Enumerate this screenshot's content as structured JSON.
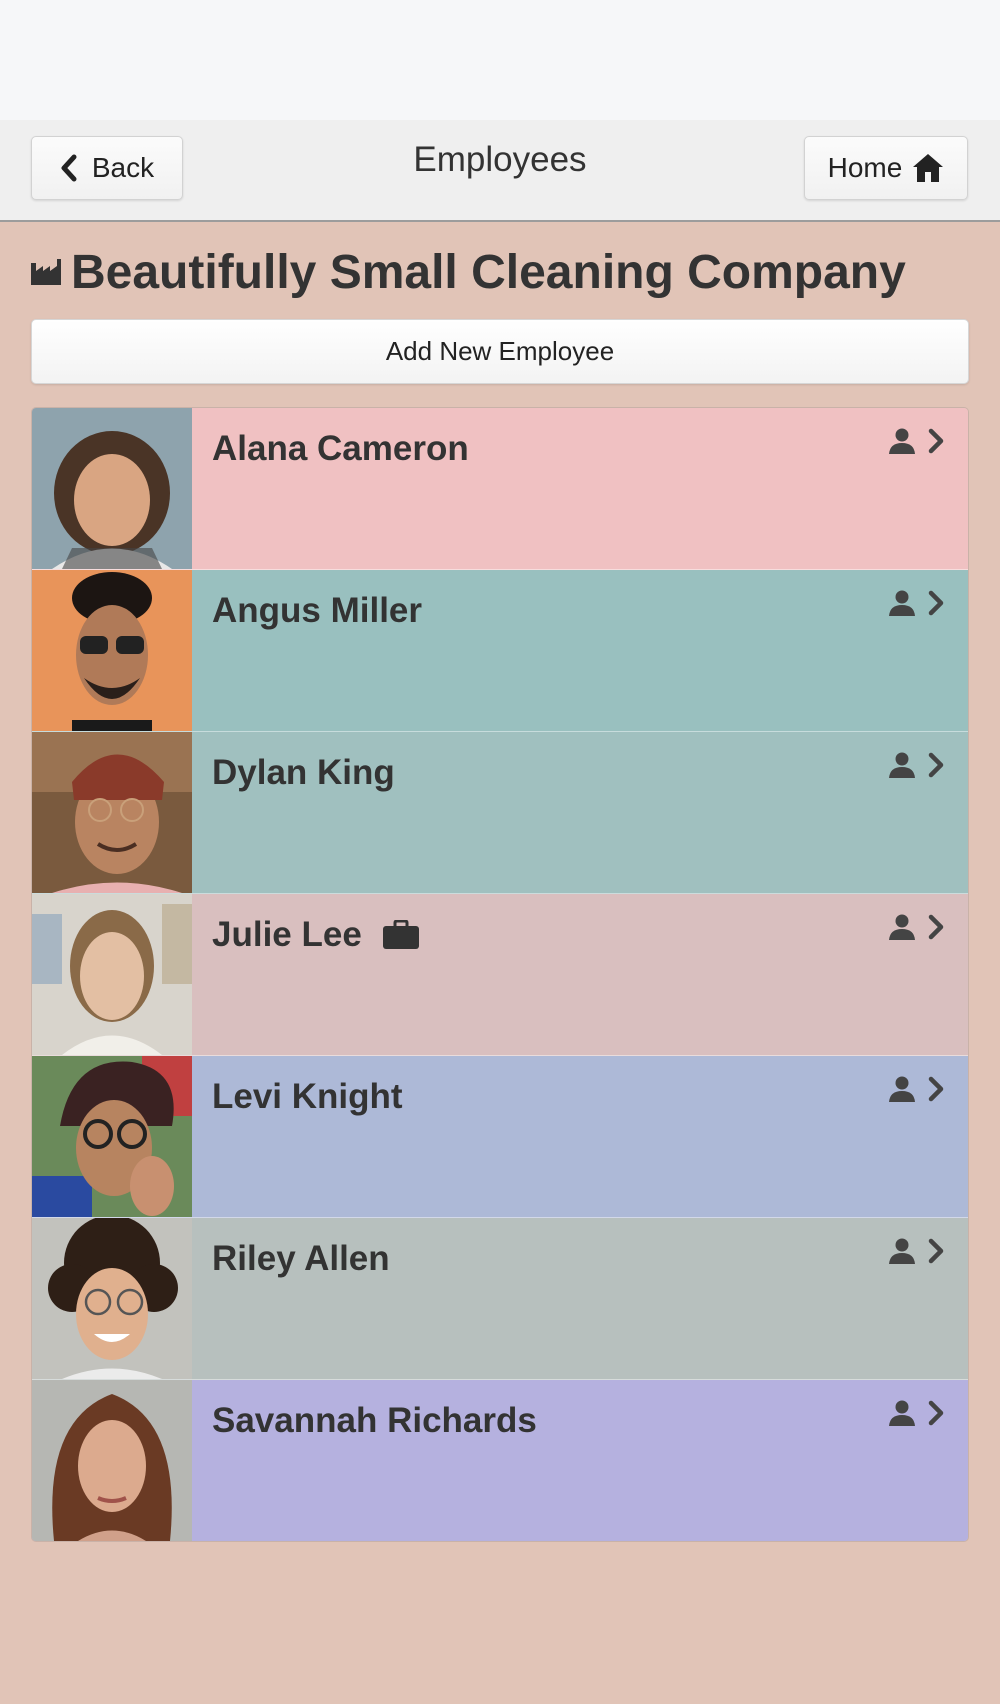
{
  "header": {
    "title": "Employees",
    "back_label": "Back",
    "home_label": "Home"
  },
  "company": {
    "name": "Beautifully Small Cleaning Company",
    "icon": "factory-icon"
  },
  "actions": {
    "add_employee_label": "Add New Employee"
  },
  "colors": {
    "page_background": "#e1c4b7",
    "header_background": "#efefef"
  },
  "employees": [
    {
      "name": "Alana Cameron",
      "row_color": "#f0c1c2",
      "badge": null
    },
    {
      "name": "Angus Miller",
      "row_color": "#99c0bf",
      "badge": null
    },
    {
      "name": "Dylan King",
      "row_color": "#a0c0bf",
      "badge": null
    },
    {
      "name": "Julie Lee",
      "row_color": "#d9bfbf",
      "badge": "briefcase-icon"
    },
    {
      "name": "Levi Knight",
      "row_color": "#adb9d7",
      "badge": null
    },
    {
      "name": "Riley Allen",
      "row_color": "#b7c0be",
      "badge": null
    },
    {
      "name": "Savannah Richards",
      "row_color": "#b5b1df",
      "badge": null
    }
  ]
}
